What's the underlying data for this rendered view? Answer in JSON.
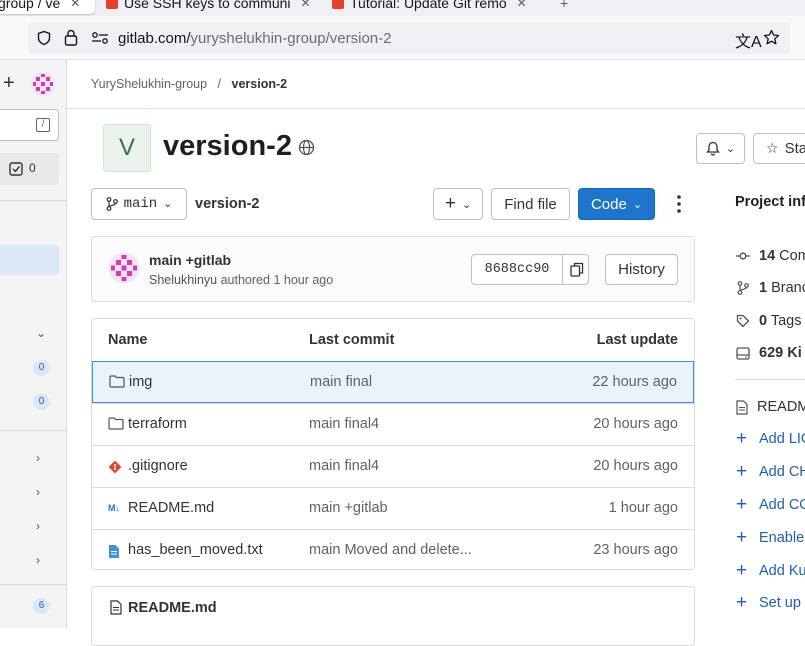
{
  "browser": {
    "tabs": [
      {
        "label": "group / ve",
        "active": true
      },
      {
        "label": "Use SSH keys to communi",
        "active": false
      },
      {
        "label": "Tutorial: Update Git remo",
        "active": false
      }
    ],
    "url_host": "gitlab.com/",
    "url_path": "yuryshelukhin-group/version-2"
  },
  "sidebar": {
    "todo_count": "0",
    "badges": [
      "0",
      "0"
    ],
    "bottom_badge": "6"
  },
  "breadcrumb": {
    "group": "YuryShelukhin-group",
    "separator": "/",
    "project": "version-2"
  },
  "project": {
    "avatar_letter": "V",
    "name": "version-2",
    "star_label": "Sta"
  },
  "repo": {
    "branch": "main",
    "path": "version-2",
    "find_file": "Find file",
    "code_label": "Code"
  },
  "last_commit": {
    "title": "main +gitlab",
    "author": "Shelukhinyu",
    "action": "authored",
    "time": "1 hour ago",
    "sha": "8688cc90",
    "history_label": "History"
  },
  "files": {
    "headers": {
      "name": "Name",
      "commit": "Last commit",
      "update": "Last update"
    },
    "rows": [
      {
        "name": "img",
        "icon": "folder-icon",
        "commit": "main final",
        "date": "22 hours ago"
      },
      {
        "name": "terraform",
        "icon": "folder-icon",
        "commit": "main final4",
        "date": "20 hours ago"
      },
      {
        "name": ".gitignore",
        "icon": "git-icon",
        "commit": "main final4",
        "date": "20 hours ago"
      },
      {
        "name": "README.md",
        "icon": "markdown-icon",
        "commit": "main +gitlab",
        "date": "1 hour ago"
      },
      {
        "name": "has_been_moved.txt",
        "icon": "text-file-icon",
        "commit": "main Moved and delete...",
        "date": "23 hours ago"
      }
    ]
  },
  "readme": {
    "title": "README.md"
  },
  "project_info": {
    "heading": "Project inf",
    "commits_count": "14",
    "commits_label": "Com",
    "branches_count": "1",
    "branches_label": "Branc",
    "tags_count": "0",
    "tags_label": "Tags",
    "size": "629 Ki",
    "readme_label": "READM",
    "add_links": [
      "Add LIC",
      "Add CH",
      "Add CO",
      "Enable",
      "Add Ku",
      "Set up"
    ]
  },
  "colors": {
    "accent": "#1f75cb",
    "highlight_row": "#e9f3fc",
    "highlight_border": "#428fdc"
  }
}
